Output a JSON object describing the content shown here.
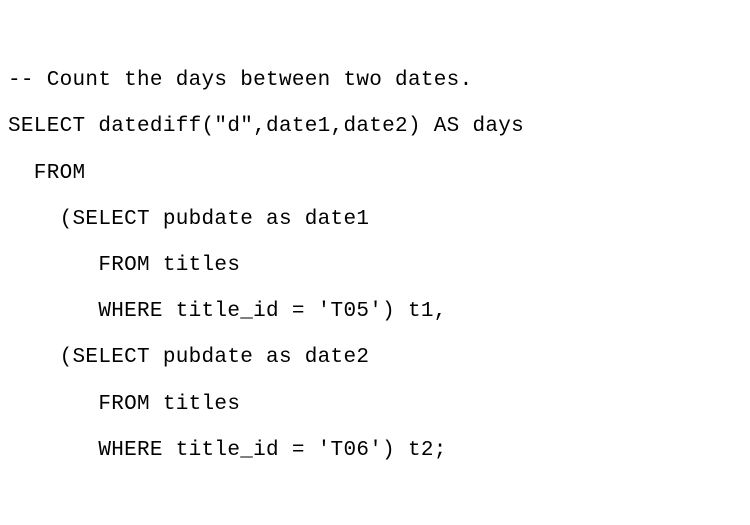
{
  "code": {
    "line1": "-- Count the days between two dates.",
    "line2": "SELECT datediff(\"d\",date1,date2) AS days",
    "line3": "  FROM",
    "line4": "    (SELECT pubdate as date1",
    "line5": "       FROM titles",
    "line6": "       WHERE title_id = 'T05') t1,",
    "line7": "    (SELECT pubdate as date2",
    "line8": "       FROM titles",
    "line9": "       WHERE title_id = 'T06') t2;"
  }
}
